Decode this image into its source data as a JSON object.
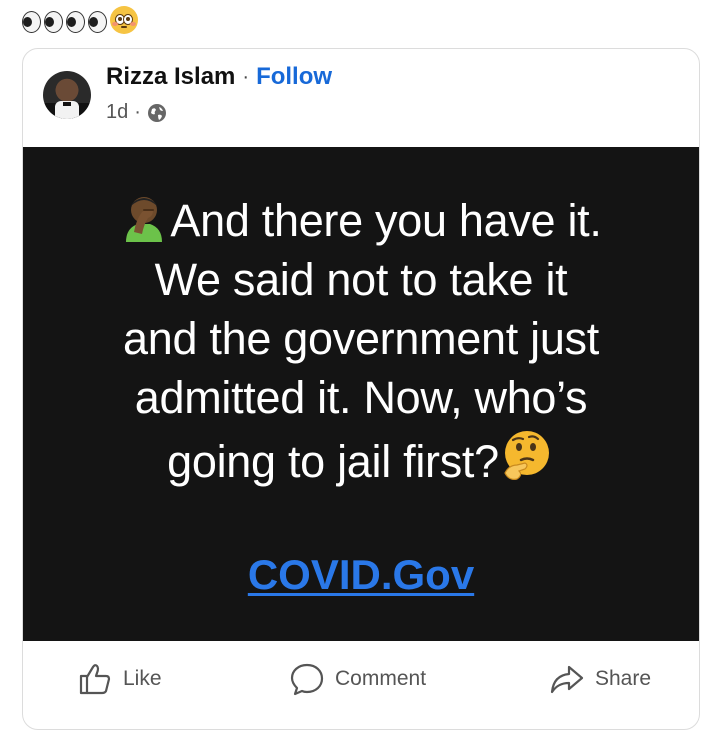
{
  "caption_emoji": [
    "eyes-icon",
    "eyes-icon",
    "flushed-face-icon"
  ],
  "post": {
    "author": "Rizza Islam",
    "separator": "·",
    "follow_label": "Follow",
    "time": "1d",
    "meta_separator": "·",
    "audience_icon": "globe-icon",
    "image": {
      "background": "#141414",
      "lines": [
        "And there you have it.",
        "We said not to take it",
        "and the government just",
        "admitted it. Now, who’s",
        "going to jail first?"
      ],
      "leading_emoji": "facepalm-icon",
      "trailing_emoji": "thinking-face-icon",
      "link_text": "COVID.Gov",
      "link_color": "#2a78e8"
    }
  },
  "actions": {
    "like": "Like",
    "comment": "Comment",
    "share": "Share"
  },
  "colors": {
    "follow": "#1769d8",
    "text_muted": "#555555"
  }
}
